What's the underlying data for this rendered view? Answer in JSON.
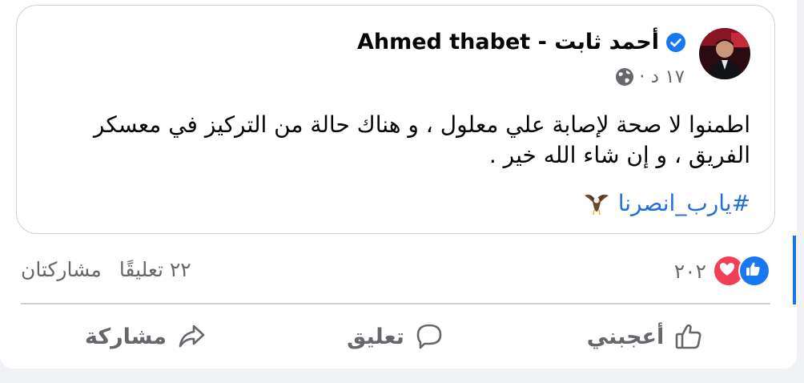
{
  "post": {
    "author": "Ahmed thabet - أحمد ثابت",
    "time": "١٧ د ·",
    "text": "اطمنوا لا صحة لإصابة علي معلول ، و هناك حالة من التركيز في معسكر الفريق ، و إن شاء الله خير .",
    "hashtag": "#يارب_انصرنا",
    "icons": {
      "verified": "verified-badge-icon",
      "privacy": "globe-icon",
      "emoji": "eagle-emoji-icon"
    }
  },
  "stats": {
    "reactions_count": "٢٠٢",
    "comments": "٢٢ تعليقًا",
    "shares": "مشاركتان"
  },
  "actions": {
    "like": "أعجبني",
    "comment": "تعليق",
    "share": "مشاركة"
  },
  "colors": {
    "accent": "#1877f2",
    "love": "#f33e58",
    "hashtag": "#216fdb",
    "muted": "#65676b"
  }
}
